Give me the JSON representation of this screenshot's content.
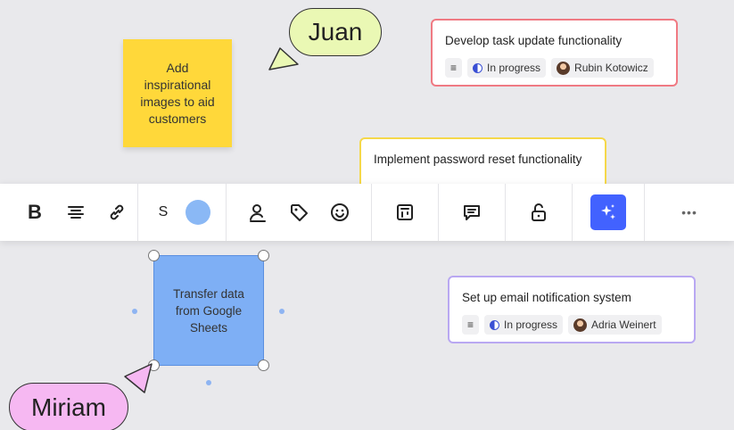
{
  "board": {
    "sticky_yellow": {
      "text": "Add inspirational images to aid customers",
      "color": "#ffd83a"
    },
    "sticky_blue": {
      "text": "Transfer data from Google Sheets",
      "color": "#7eaff5"
    }
  },
  "cursors": [
    {
      "name": "Juan",
      "color": "#eaf8b4"
    },
    {
      "name": "Miriam",
      "color": "#f6b8f2"
    }
  ],
  "cards": [
    {
      "title": "Develop task update functionality",
      "status": "In progress",
      "assignee": "Rubin Kotowicz",
      "accent": "#f07a83"
    },
    {
      "title": "Implement password reset functionality",
      "accent": "#f5d84a"
    },
    {
      "title": "Set up email notification system",
      "status": "In progress",
      "assignee": "Adria Weinert",
      "accent": "#b9a8f2"
    }
  ],
  "toolbar": {
    "bold_label": "B",
    "font_size_label": "S",
    "selected_color": "#8ab8f5",
    "more_label": "•••",
    "accent": "#4262ff"
  }
}
